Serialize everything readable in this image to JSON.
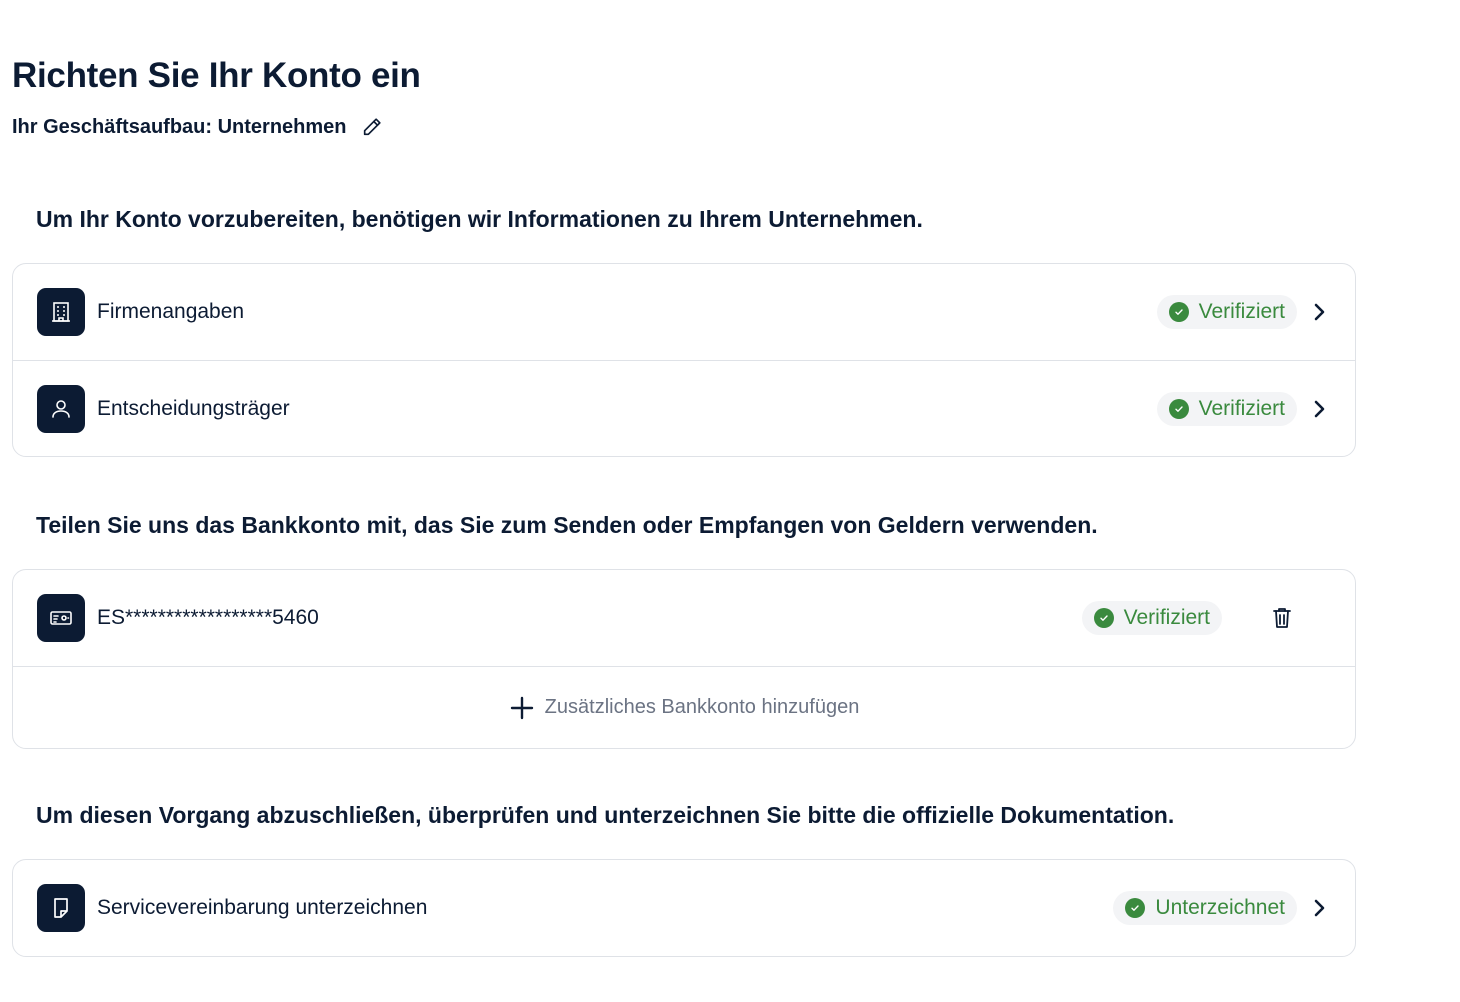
{
  "header": {
    "title": "Richten Sie Ihr Konto ein",
    "business_structure": "Ihr Geschäftsaufbau: Unternehmen"
  },
  "company_section": {
    "heading": "Um Ihr Konto vorzubereiten, benötigen wir Informationen zu Ihrem Unternehmen.",
    "items": [
      {
        "label": "Firmenangaben",
        "icon": "building-icon",
        "status": "Verifiziert"
      },
      {
        "label": "Entscheidungsträger",
        "icon": "person-icon",
        "status": "Verifiziert"
      }
    ]
  },
  "bank_section": {
    "heading": "Teilen Sie uns das Bankkonto mit, das Sie zum Senden oder Empfangen von Geldern verwenden.",
    "accounts": [
      {
        "label": "ES******************5460",
        "icon": "bank-card-icon",
        "status": "Verifiziert"
      }
    ],
    "add_label": "Zusätzliches Bankkonto hinzufügen"
  },
  "document_section": {
    "heading": "Um diesen Vorgang abzuschließen, überprüfen und unterzeichnen Sie bitte die offizielle Dokumentation.",
    "items": [
      {
        "label": "Servicevereinbarung unterzeichnen",
        "icon": "document-icon",
        "status": "Unterzeichnet"
      }
    ]
  },
  "colors": {
    "primary": "#0c1b33",
    "success": "#3a8a3e",
    "badge_bg": "#f3f4f6",
    "border": "#dfe2e7",
    "muted_text": "#6b7383"
  }
}
